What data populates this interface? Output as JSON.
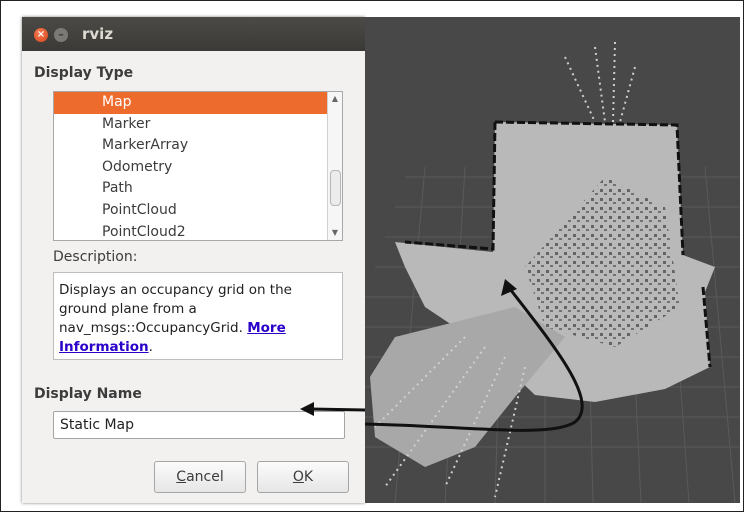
{
  "window": {
    "title": "rviz",
    "close_glyph": "×",
    "minimize_glyph": "–"
  },
  "display_type": {
    "label": "Display Type",
    "items": [
      {
        "label": "Map",
        "selected": true
      },
      {
        "label": "Marker",
        "selected": false
      },
      {
        "label": "MarkerArray",
        "selected": false
      },
      {
        "label": "Odometry",
        "selected": false
      },
      {
        "label": "Path",
        "selected": false
      },
      {
        "label": "PointCloud",
        "selected": false
      },
      {
        "label": "PointCloud2",
        "selected": false
      }
    ]
  },
  "description": {
    "label": "Description:",
    "text": "Displays an occupancy grid on the ground plane from a nav_msgs::OccupancyGrid.",
    "link_more": "More",
    "link_information": "Information",
    "trailing": "."
  },
  "display_name": {
    "label": "Display Name",
    "value": "Static Map"
  },
  "buttons": {
    "cancel": "Cancel",
    "ok": "OK"
  },
  "colors": {
    "accent": "#ee6b2e",
    "viewport_bg": "#484848",
    "map_free": "#b9b9b9",
    "arrow": "#111111"
  },
  "icons": {
    "scroll_up": "scroll-up-icon",
    "scroll_down": "scroll-down-icon"
  }
}
